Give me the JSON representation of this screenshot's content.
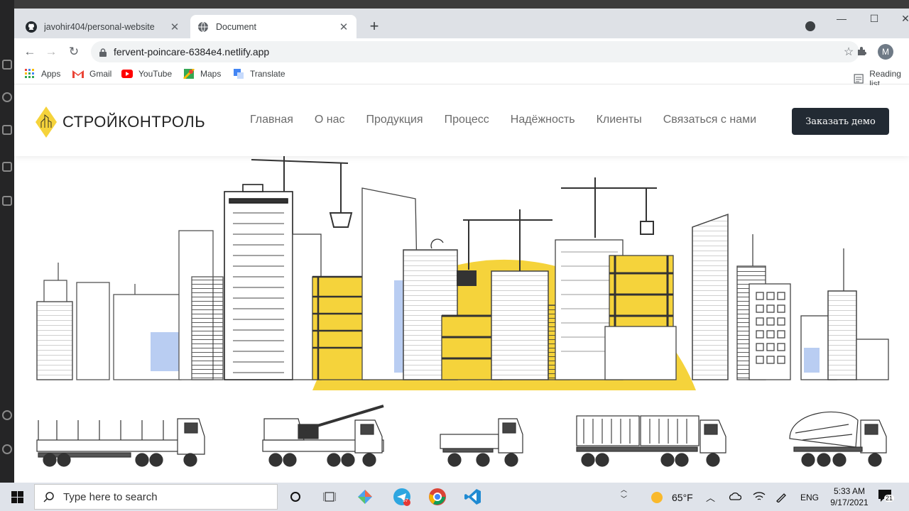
{
  "browser": {
    "tabs": [
      {
        "title": "javohir404/personal-website",
        "active": false,
        "icon": "github-icon"
      },
      {
        "title": "Document",
        "active": true,
        "icon": "globe-icon"
      }
    ],
    "url": "fervent-poincare-6384e4.netlify.app",
    "profile_initial": "M",
    "bookmarks": [
      {
        "label": "Apps",
        "icon": "apps-grid-icon"
      },
      {
        "label": "Gmail",
        "icon": "gmail-icon"
      },
      {
        "label": "YouTube",
        "icon": "youtube-icon"
      },
      {
        "label": "Maps",
        "icon": "maps-icon"
      },
      {
        "label": "Translate",
        "icon": "translate-icon"
      }
    ],
    "reading_list": "Reading list"
  },
  "site": {
    "logo_text": "СТРОЙКОНТРОЛЬ",
    "nav": [
      "Главная",
      "О нас",
      "Продукция",
      "Процесс",
      "Надёжность",
      "Клиенты",
      "Связаться с нами"
    ],
    "cta": "Заказать демо",
    "accent": "#f5d33b",
    "dark": "#222a33"
  },
  "taskbar": {
    "search_placeholder": "Type here to search",
    "weather": "65°F",
    "language": "ENG",
    "time": "5:33 AM",
    "date": "9/17/2021",
    "notifications": "21",
    "telegram_badge": "57"
  }
}
